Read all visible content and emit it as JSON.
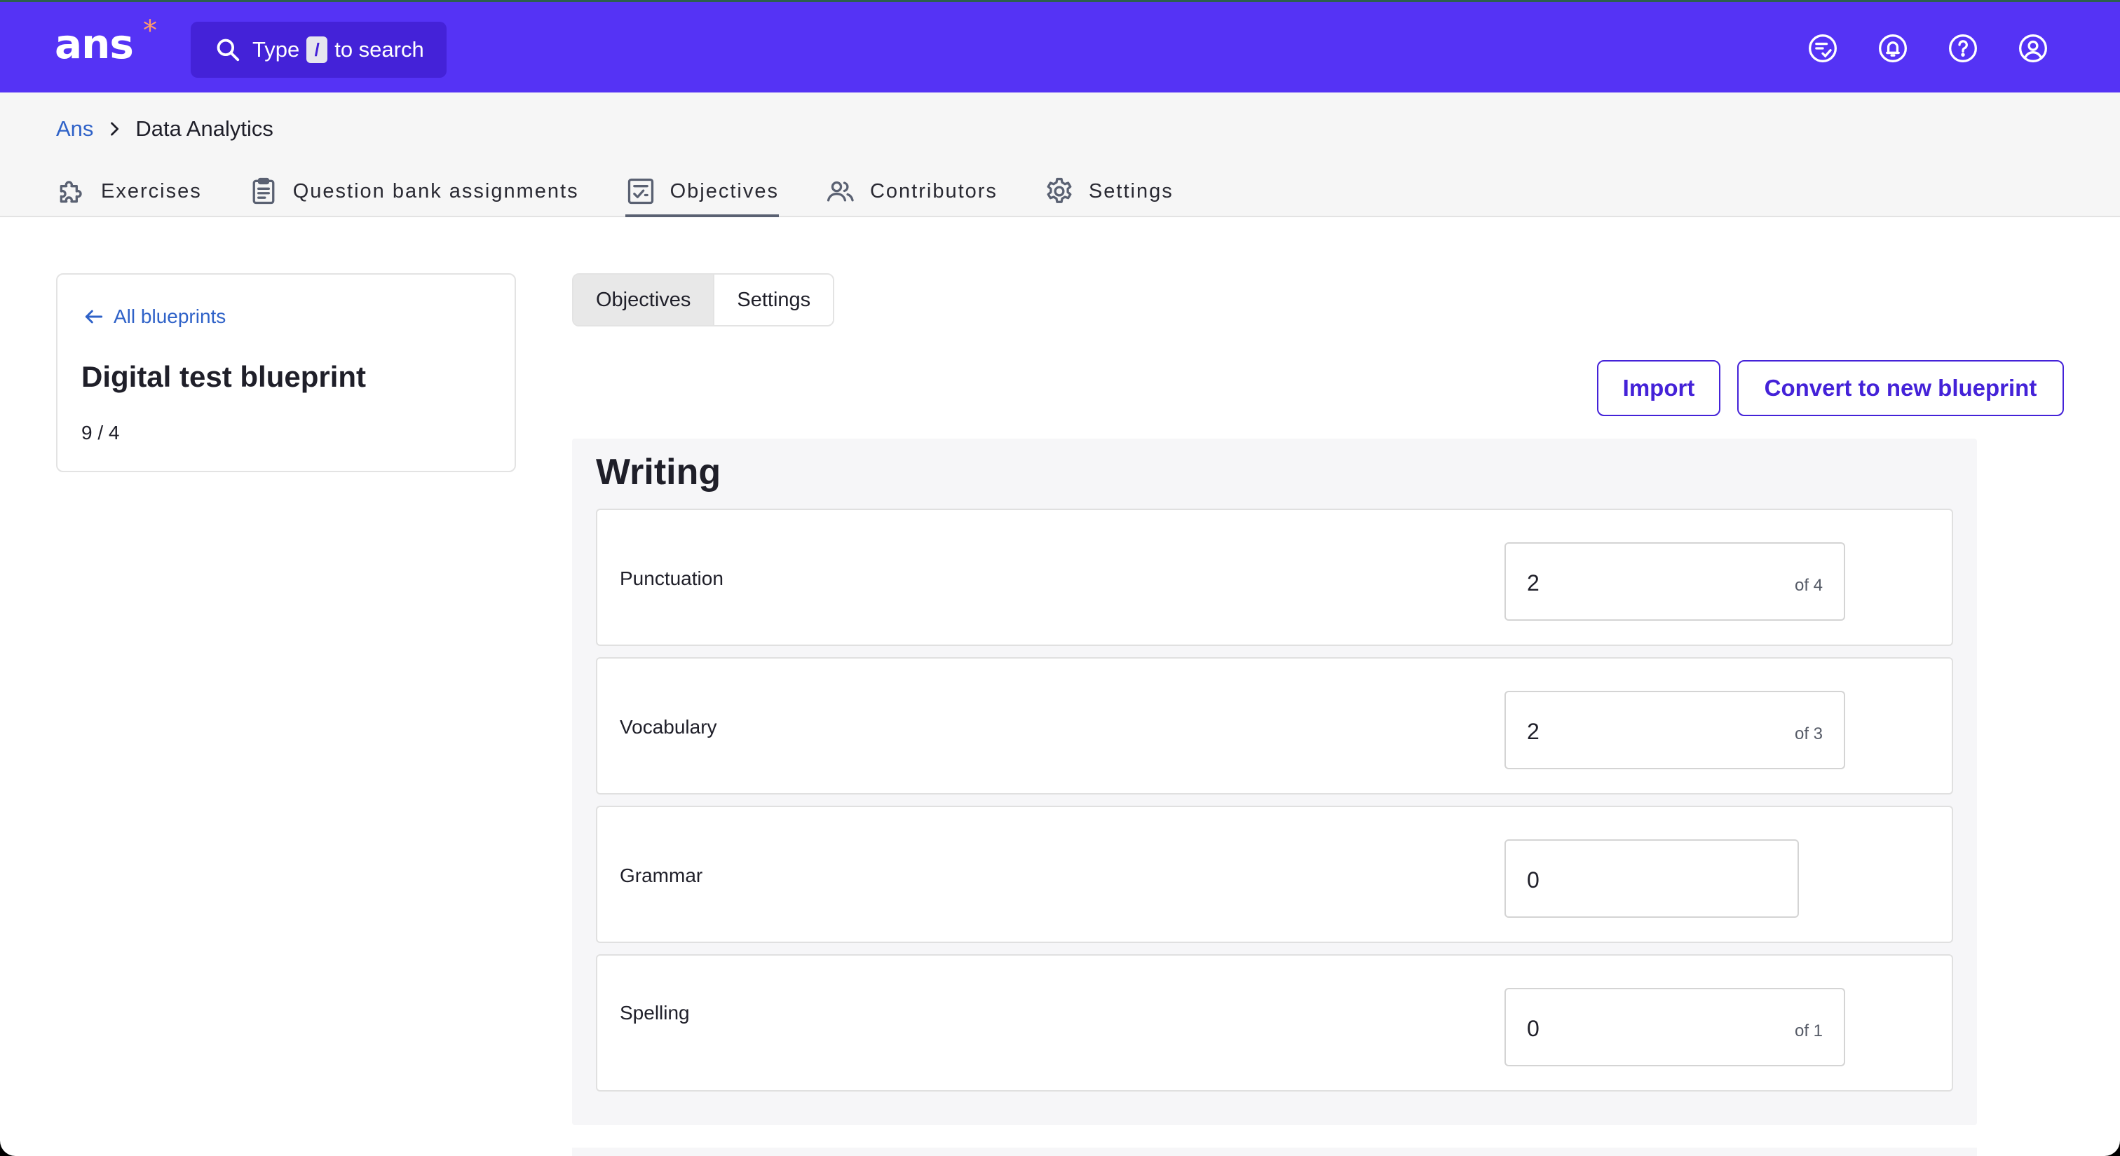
{
  "header": {
    "logo_text": "ans",
    "logo_mark": "*",
    "search": {
      "prefix": "Type",
      "key": "/",
      "suffix": "to search",
      "icon": "search-icon"
    },
    "icons": [
      "checklist-icon",
      "bell-icon",
      "help-icon",
      "account-icon"
    ]
  },
  "breadcrumb": {
    "root": "Ans",
    "current": "Data Analytics"
  },
  "tabs": [
    {
      "label": "Exercises",
      "icon": "puzzle-icon"
    },
    {
      "label": "Question bank assignments",
      "icon": "clipboard-icon"
    },
    {
      "label": "Objectives",
      "icon": "checkbox-list-icon",
      "active": true
    },
    {
      "label": "Contributors",
      "icon": "users-icon"
    },
    {
      "label": "Settings",
      "icon": "gear-icon"
    }
  ],
  "blueprint": {
    "back_label": "All blueprints",
    "title": "Digital test blueprint",
    "count": "9 / 4"
  },
  "segmented": {
    "objectives_label": "Objectives",
    "settings_label": "Settings",
    "active": "Objectives"
  },
  "actions": {
    "import_label": "Import",
    "convert_label": "Convert to new blueprint"
  },
  "section": {
    "title": "Writing",
    "objectives": [
      {
        "label": "Punctuation",
        "value": "2",
        "of": "of 4"
      },
      {
        "label": "Vocabulary",
        "value": "2",
        "of": "of 3"
      },
      {
        "label": "Grammar",
        "value": "0",
        "of": ""
      },
      {
        "label": "Spelling",
        "value": "0",
        "of": "of 1"
      }
    ]
  },
  "colors": {
    "brand": "#5533f5",
    "link": "#2f62c8",
    "button_outline": "#4422d8"
  }
}
